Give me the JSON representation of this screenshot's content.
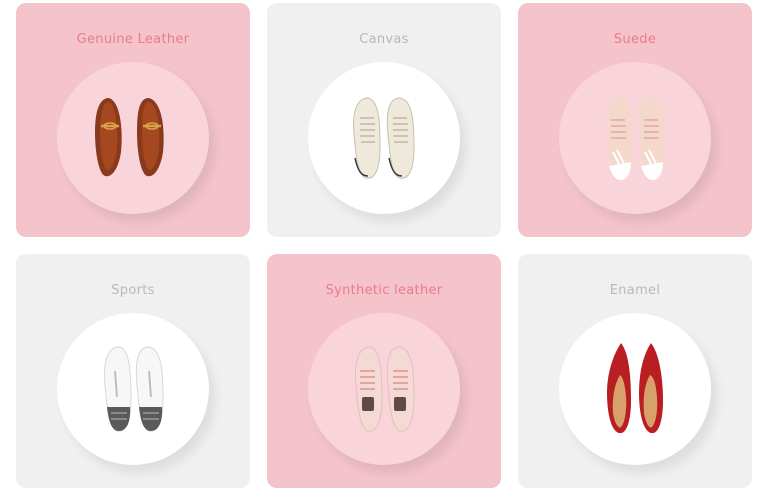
{
  "cards": [
    {
      "title": "Genuine Leather",
      "icon": "leather-loafers-icon"
    },
    {
      "title": "Canvas",
      "icon": "canvas-sneakers-icon"
    },
    {
      "title": "Suede",
      "icon": "suede-sneakers-icon"
    },
    {
      "title": "Sports",
      "icon": "sports-sneakers-icon"
    },
    {
      "title": "Synthetic leather",
      "icon": "synthetic-leather-sneakers-icon"
    },
    {
      "title": "Enamel",
      "icon": "enamel-flats-icon"
    }
  ],
  "colors": {
    "pink_card": "#f4c3cb",
    "grey_card": "#f0f0f0",
    "pink_title": "#e97c8c",
    "grey_title": "#b8b8b8"
  }
}
